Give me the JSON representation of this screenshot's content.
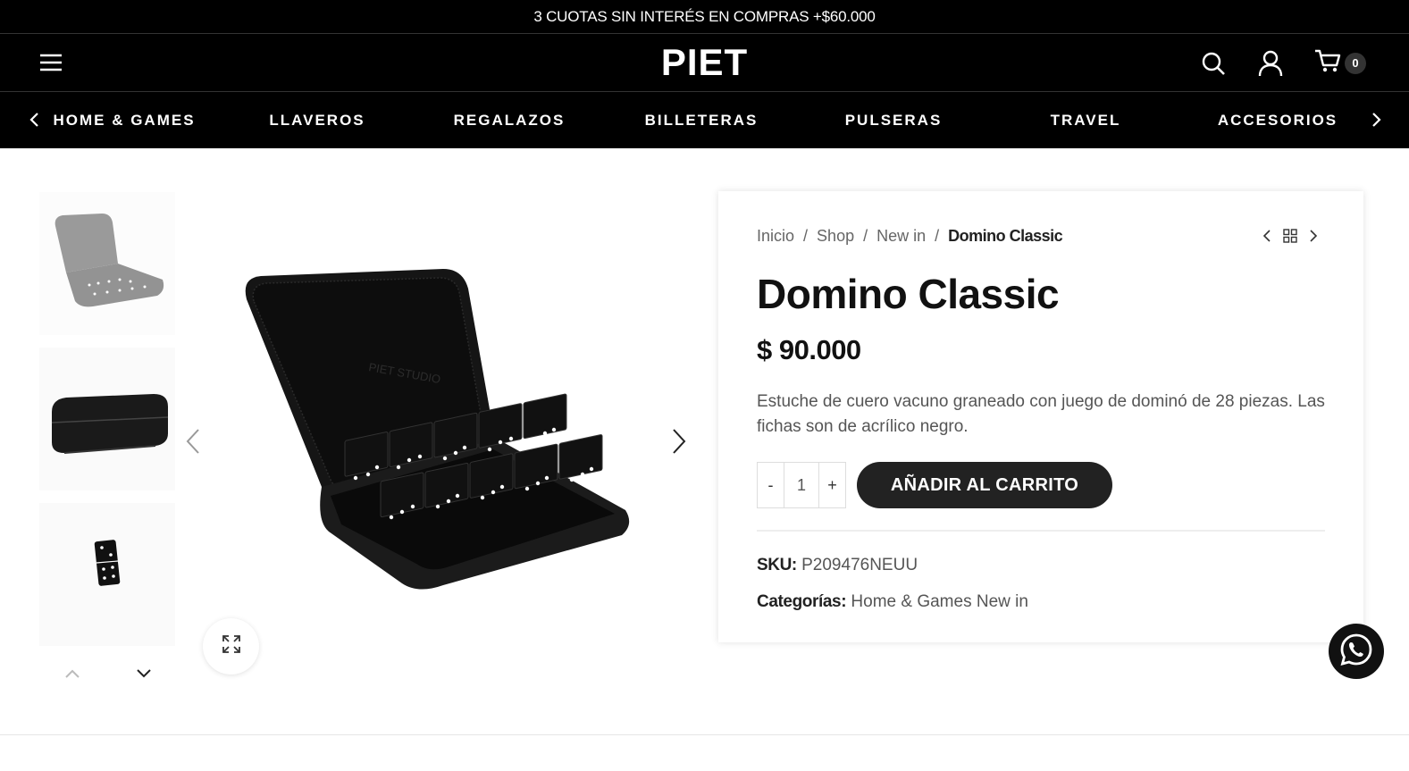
{
  "topbar": {
    "text": "3 CUOTAS SIN INTERÉS EN COMPRAS +$60.000"
  },
  "header": {
    "logo": "PIET",
    "cart_count": "0"
  },
  "categories": [
    "HOME & GAMES",
    "LLAVEROS",
    "REGALAZOS",
    "BILLETERAS",
    "PULSERAS",
    "TRAVEL",
    "ACCESORIOS"
  ],
  "breadcrumb": {
    "items": [
      "Inicio",
      "Shop",
      "New in"
    ],
    "separator": "/",
    "current": "Domino Classic"
  },
  "product": {
    "title": "Domino Classic",
    "price": "$ 90.000",
    "description": "Estuche de cuero vacuno graneado con juego de dominó de 28 piezas. Las fichas son de acrílico negro.",
    "quantity": "1",
    "minus_label": "-",
    "plus_label": "+",
    "add_to_cart": "AÑADIR AL CARRITO",
    "sku_label": "SKU:",
    "sku": "P209476NEUU",
    "categories_label": "Categorías:",
    "categories": [
      "Home & Games",
      "New in"
    ],
    "case_imprint": "PIET STUDIO"
  },
  "colors": {
    "brand_black": "#000000",
    "button": "#222222"
  }
}
